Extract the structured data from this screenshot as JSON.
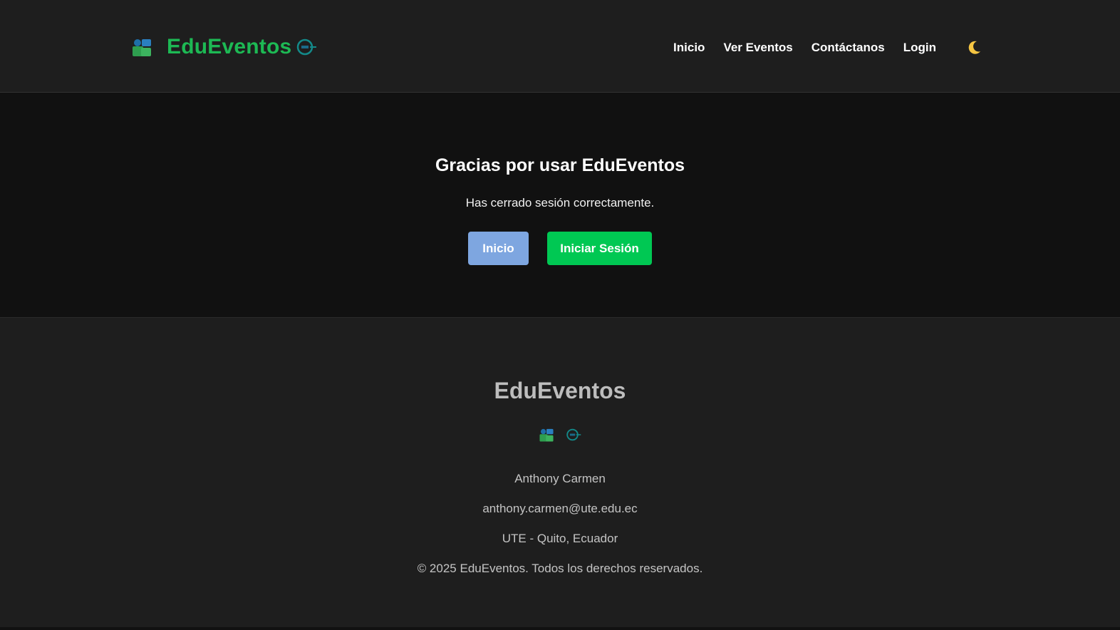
{
  "header": {
    "brand_name": "EduEventos",
    "nav": {
      "inicio": "Inicio",
      "ver_eventos": "Ver Eventos",
      "contactanos": "Contáctanos",
      "login": "Login"
    },
    "theme_icon": "moon-icon"
  },
  "hero": {
    "title": "Gracias por usar EduEventos",
    "subtitle": "Has cerrado sesión correctamente.",
    "btn_inicio": "Inicio",
    "btn_login": "Iniciar Sesión"
  },
  "footer": {
    "title": "EduEventos",
    "author": "Anthony Carmen",
    "email": "anthony.carmen@ute.edu.ec",
    "location": "UTE - Quito, Ecuador",
    "copyright": "© 2025 EduEventos. Todos los derechos reservados."
  },
  "colors": {
    "brand_green": "#1db954",
    "button_blue": "#7ea6e0",
    "button_green": "#00c853"
  }
}
